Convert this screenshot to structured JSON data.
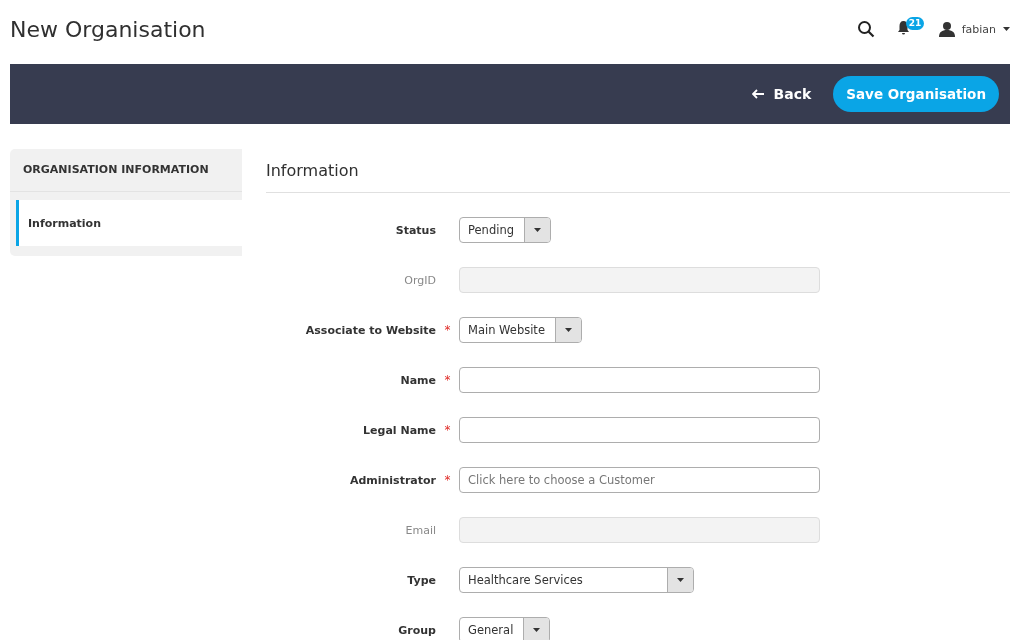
{
  "page_title": "New Organisation",
  "header": {
    "notification_count": "21",
    "user": "fabian"
  },
  "actions": {
    "back": "Back",
    "save": "Save Organisation"
  },
  "sidebar": {
    "title": "ORGANISATION INFORMATION",
    "items": [
      {
        "label": "Information",
        "selected": true
      }
    ]
  },
  "section_title": "Information",
  "fields": [
    {
      "kind": "select",
      "label": "Status",
      "disabled": false,
      "value": "Pending"
    },
    {
      "kind": "text",
      "label": "OrgID",
      "disabled": true
    },
    {
      "kind": "select",
      "label": "Associate to Website",
      "required_mark": "*",
      "disabled": false,
      "value": "Main Website"
    },
    {
      "kind": "text",
      "label": "Name",
      "required_mark": "*",
      "disabled": false
    },
    {
      "kind": "text",
      "label": "Legal Name",
      "required_mark": "*",
      "disabled": false
    },
    {
      "kind": "text",
      "label": "Administrator",
      "required_mark": "*",
      "disabled": false,
      "placeholder": "Click here to choose a Customer"
    },
    {
      "kind": "text",
      "label": "Email",
      "disabled": true
    },
    {
      "kind": "wideselect",
      "label": "Type",
      "disabled": false,
      "value": "Healthcare Services"
    },
    {
      "kind": "select",
      "label": "Group",
      "disabled": false,
      "value": "General"
    }
  ]
}
